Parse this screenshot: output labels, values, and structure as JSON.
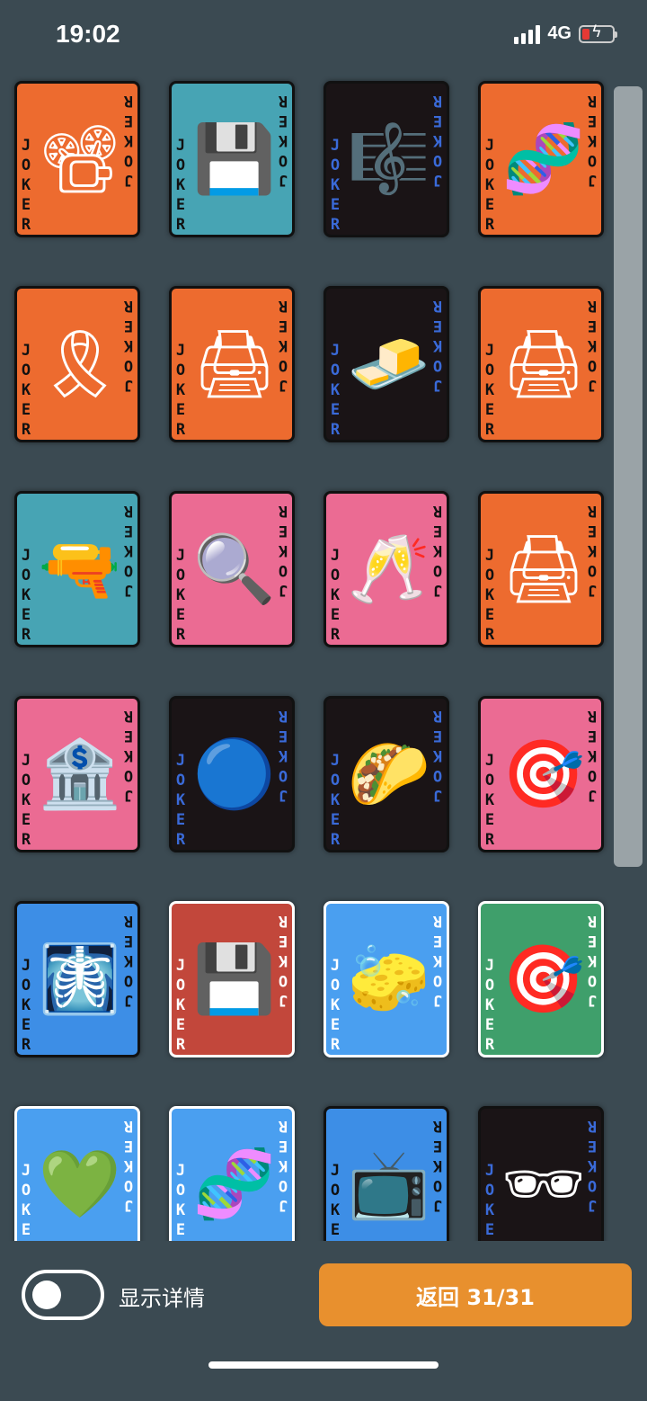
{
  "status_bar": {
    "time": "19:02",
    "network": "4G"
  },
  "cards": [
    {
      "bg": "#ed6b2f",
      "text_color": "#111111",
      "icon": "film-projector-icon",
      "glyph": "📽",
      "joker": "JOKER",
      "border": "#111111"
    },
    {
      "bg": "#47a4b4",
      "text_color": "#111111",
      "icon": "floppy-disk-icon",
      "glyph": "💾",
      "joker": "JOKER",
      "border": "#111111"
    },
    {
      "bg": "#1a1416",
      "text_color": "#3a6ad8",
      "icon": "treble-clef-icon",
      "glyph": "🎼",
      "joker": "JOKER",
      "border": "#111111"
    },
    {
      "bg": "#ed6b2f",
      "text_color": "#111111",
      "icon": "dna-icon",
      "glyph": "🧬",
      "joker": "JOKER",
      "border": "#111111"
    },
    {
      "bg": "#ed6b2f",
      "text_color": "#111111",
      "icon": "ribbon-icon",
      "glyph": "🎗",
      "joker": "JOKER",
      "border": "#111111"
    },
    {
      "bg": "#ed6b2f",
      "text_color": "#111111",
      "icon": "printer-icon",
      "glyph": "🖨",
      "joker": "JOKER",
      "border": "#111111"
    },
    {
      "bg": "#1a1416",
      "text_color": "#3a6ad8",
      "icon": "butter-icon",
      "glyph": "🧈",
      "joker": "JOKER",
      "border": "#111111"
    },
    {
      "bg": "#ed6b2f",
      "text_color": "#111111",
      "icon": "printer-icon",
      "glyph": "🖨",
      "joker": "JOKER",
      "border": "#111111"
    },
    {
      "bg": "#47a4b4",
      "text_color": "#111111",
      "icon": "water-pistol-icon",
      "glyph": "🔫",
      "joker": "JOKER",
      "border": "#111111"
    },
    {
      "bg": "#eb6b93",
      "text_color": "#111111",
      "icon": "magnifying-glass-icon",
      "glyph": "🔍",
      "joker": "JOKER",
      "border": "#111111"
    },
    {
      "bg": "#eb6b93",
      "text_color": "#111111",
      "icon": "champagne-glasses-icon",
      "glyph": "🥂",
      "joker": "JOKER",
      "border": "#111111"
    },
    {
      "bg": "#ed6b2f",
      "text_color": "#111111",
      "icon": "printer-icon",
      "glyph": "🖨",
      "joker": "JOKER",
      "border": "#111111"
    },
    {
      "bg": "#eb6b93",
      "text_color": "#111111",
      "icon": "bank-icon",
      "glyph": "🏦",
      "joker": "JOKER",
      "border": "#111111"
    },
    {
      "bg": "#1a1416",
      "text_color": "#3a6ad8",
      "icon": "blue-face-icon",
      "glyph": "🔵",
      "joker": "JOKER",
      "border": "#111111"
    },
    {
      "bg": "#1a1416",
      "text_color": "#3a6ad8",
      "icon": "taco-icon",
      "glyph": "🌮",
      "joker": "JOKER",
      "border": "#111111"
    },
    {
      "bg": "#eb6b93",
      "text_color": "#111111",
      "icon": "direct-hit-icon",
      "glyph": "🎯",
      "joker": "JOKER",
      "border": "#111111"
    },
    {
      "bg": "#3d8ee6",
      "text_color": "#111111",
      "icon": "x-ray-icon",
      "glyph": "🩻",
      "joker": "JOKER",
      "border": "#111111"
    },
    {
      "bg": "#c2473b",
      "text_color": "#ffffff",
      "icon": "floppy-disk-icon",
      "glyph": "💾",
      "joker": "JOKER",
      "border": "#ffffff"
    },
    {
      "bg": "#4a9ff0",
      "text_color": "#ffffff",
      "icon": "sponge-icon",
      "glyph": "🧽",
      "joker": "JOKER",
      "border": "#ffffff"
    },
    {
      "bg": "#3f9f6b",
      "text_color": "#ffffff",
      "icon": "direct-hit-icon",
      "glyph": "🎯",
      "joker": "JOKER",
      "border": "#ffffff"
    },
    {
      "bg": "#4a9ff0",
      "text_color": "#ffffff",
      "icon": "green-heart-icon",
      "glyph": "💚",
      "joker": "JOKER",
      "border": "#ffffff"
    },
    {
      "bg": "#4a9ff0",
      "text_color": "#ffffff",
      "icon": "dna-icon",
      "glyph": "🧬",
      "joker": "JOKER",
      "border": "#ffffff"
    },
    {
      "bg": "#3d8ee6",
      "text_color": "#111111",
      "icon": "television-icon",
      "glyph": "📺",
      "joker": "JOKER",
      "border": "#111111"
    },
    {
      "bg": "#1a1416",
      "text_color": "#3a6ad8",
      "icon": "sunglasses-icon",
      "glyph": "🕶",
      "joker": "JOKER",
      "border": "#111111"
    }
  ],
  "bottom": {
    "toggle_label": "显示详情",
    "toggle_on": false,
    "return_label": "返回 31/31"
  }
}
